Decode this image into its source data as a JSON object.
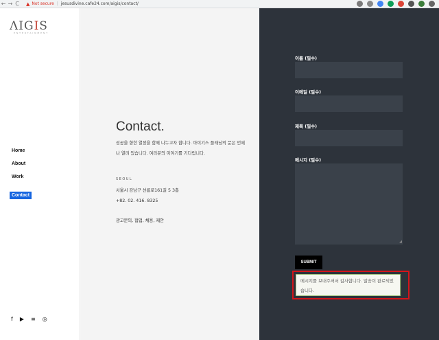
{
  "browser": {
    "back": "←",
    "forward": "→",
    "reload": "C",
    "warning_icon": "▲",
    "not_secure": "Not secure",
    "separator": "|",
    "url": "jesusdivine.cafe24.com/aigis/contact/"
  },
  "logo": {
    "main": "ΛIG",
    "accent": "I",
    "end": "S",
    "sub": "ENTERTAINMENT"
  },
  "nav": {
    "items": [
      {
        "label": "Home"
      },
      {
        "label": "About"
      },
      {
        "label": "Work"
      },
      {
        "label": "Contact"
      }
    ]
  },
  "socials": [
    "f",
    "▶",
    "≡",
    "◎"
  ],
  "contact": {
    "title": "Contact.",
    "intro": "성공을 향한 열정을 함께 나누고자 합니다. 아이기스 플래닝의 문은 언제나 열려 있습니다. 여러분의 이야기를 기다립니다.",
    "city": "SEOUL",
    "address": "서울시 강남구 선릉로161길 5 3층",
    "phone": "+82. 02. 416. 8325",
    "inquiry": "광고문의, 협업, 채용, 제안"
  },
  "form": {
    "name_label": "이름 (필수)",
    "email_label": "이메일 (필수)",
    "subject_label": "제목 (필수)",
    "message_label": "메시지 (필수)",
    "name_value": "",
    "email_value": "",
    "subject_value": "",
    "message_value": "",
    "submit_label": "SUBMIT",
    "success_message": "메시지를 보내주셔서 감사합니다. 발송이 완료되었습니다."
  },
  "colors": {
    "nav_active": "#1565e0",
    "right_panel": "#2d333b",
    "field_bg": "#3a414a",
    "highlight": "#d4151a"
  }
}
